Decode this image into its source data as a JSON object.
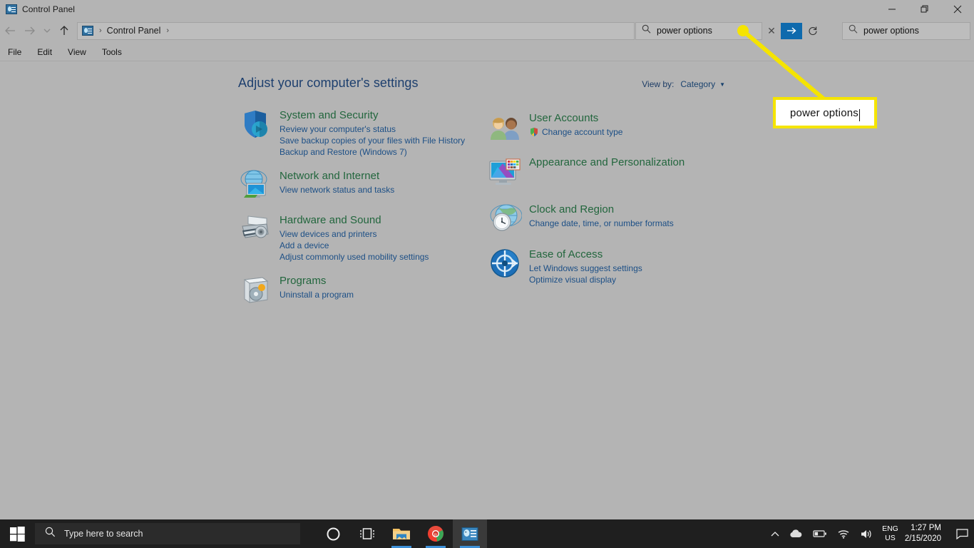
{
  "window": {
    "title": "Control Panel",
    "app_icon": "control-panel-icon",
    "controls": {
      "minimize": "Minimize",
      "restore": "Restore",
      "close": "Close"
    }
  },
  "nav": {
    "back": "Back",
    "forward": "Forward",
    "recent": "Recent locations",
    "up": "Up one level",
    "breadcrumb": {
      "root_icon": "control-panel-icon",
      "separator": "›",
      "item": "Control Panel",
      "trailing": "›"
    }
  },
  "search": {
    "primary": {
      "value": "power options",
      "placeholder": "Search Control Panel",
      "clear": "✕",
      "go": "→",
      "refresh": "↻"
    },
    "secondary": {
      "value": "power options",
      "placeholder": "Search",
      "clear": "✕",
      "go": "→"
    }
  },
  "menubar": {
    "items": [
      "File",
      "Edit",
      "View",
      "Tools"
    ]
  },
  "main": {
    "heading": "Adjust your computer's settings",
    "view_by": {
      "label": "View by:",
      "value": "Category",
      "caret": "▼"
    },
    "left_column": [
      {
        "id": "system-and-security",
        "icon": "shield-icon",
        "title": "System and Security",
        "links": [
          "Review your computer's status",
          "Save backup copies of your files with File History",
          "Backup and Restore (Windows 7)"
        ]
      },
      {
        "id": "network-and-internet",
        "icon": "network-globe-monitor-icon",
        "title": "Network and Internet",
        "links": [
          "View network status and tasks"
        ]
      },
      {
        "id": "hardware-and-sound",
        "icon": "printer-icon",
        "title": "Hardware and Sound",
        "links": [
          "View devices and printers",
          "Add a device",
          "Adjust commonly used mobility settings"
        ]
      },
      {
        "id": "programs",
        "icon": "programs-disc-icon",
        "title": "Programs",
        "links": [
          "Uninstall a program"
        ]
      }
    ],
    "right_column": [
      {
        "id": "user-accounts",
        "icon": "users-icon",
        "title": "User Accounts",
        "links": [
          "Change account type"
        ],
        "shield_on_first_link": true
      },
      {
        "id": "appearance-and-personalization",
        "icon": "monitor-palette-icon",
        "title": "Appearance and Personalization",
        "links": []
      },
      {
        "id": "clock-and-region",
        "icon": "clock-globe-icon",
        "title": "Clock and Region",
        "links": [
          "Change date, time, or number formats"
        ]
      },
      {
        "id": "ease-of-access",
        "icon": "ease-of-access-icon",
        "title": "Ease of Access",
        "links": [
          "Let Windows suggest settings",
          "Optimize visual display"
        ]
      }
    ]
  },
  "annotation": {
    "callout_text": "power options",
    "highlight_color": "#f5e400",
    "box_background": "#ffffff"
  },
  "taskbar": {
    "start": "start-button",
    "search_placeholder": "Type here to search",
    "search_icon": "search-icon",
    "pinned": [
      {
        "id": "cortana",
        "icon": "cortana-circle-icon",
        "active": false
      },
      {
        "id": "task-view",
        "icon": "task-view-icon",
        "active": false
      },
      {
        "id": "file-explorer",
        "icon": "folder-icon",
        "active": false,
        "running": true
      },
      {
        "id": "chrome",
        "icon": "chrome-icon",
        "active": false,
        "running": true
      },
      {
        "id": "control-panel",
        "icon": "control-panel-icon",
        "active": true,
        "running": true
      }
    ],
    "tray": {
      "overflow": "∧",
      "icons": [
        "cloud-icon",
        "battery-icon",
        "wifi-icon",
        "volume-icon"
      ],
      "language": {
        "line1": "ENG",
        "line2": "US"
      },
      "clock": {
        "time": "1:27 PM",
        "date": "2/15/2020"
      },
      "action_center": "action-center-icon"
    }
  },
  "colors": {
    "window_bg": "#b4b4b4",
    "accent_blue": "#0e6aad",
    "category_title": "#22663d",
    "link_blue": "#1c4f86",
    "heading_blue": "#1d3f6e",
    "taskbar_bg": "#1f1f1f"
  }
}
